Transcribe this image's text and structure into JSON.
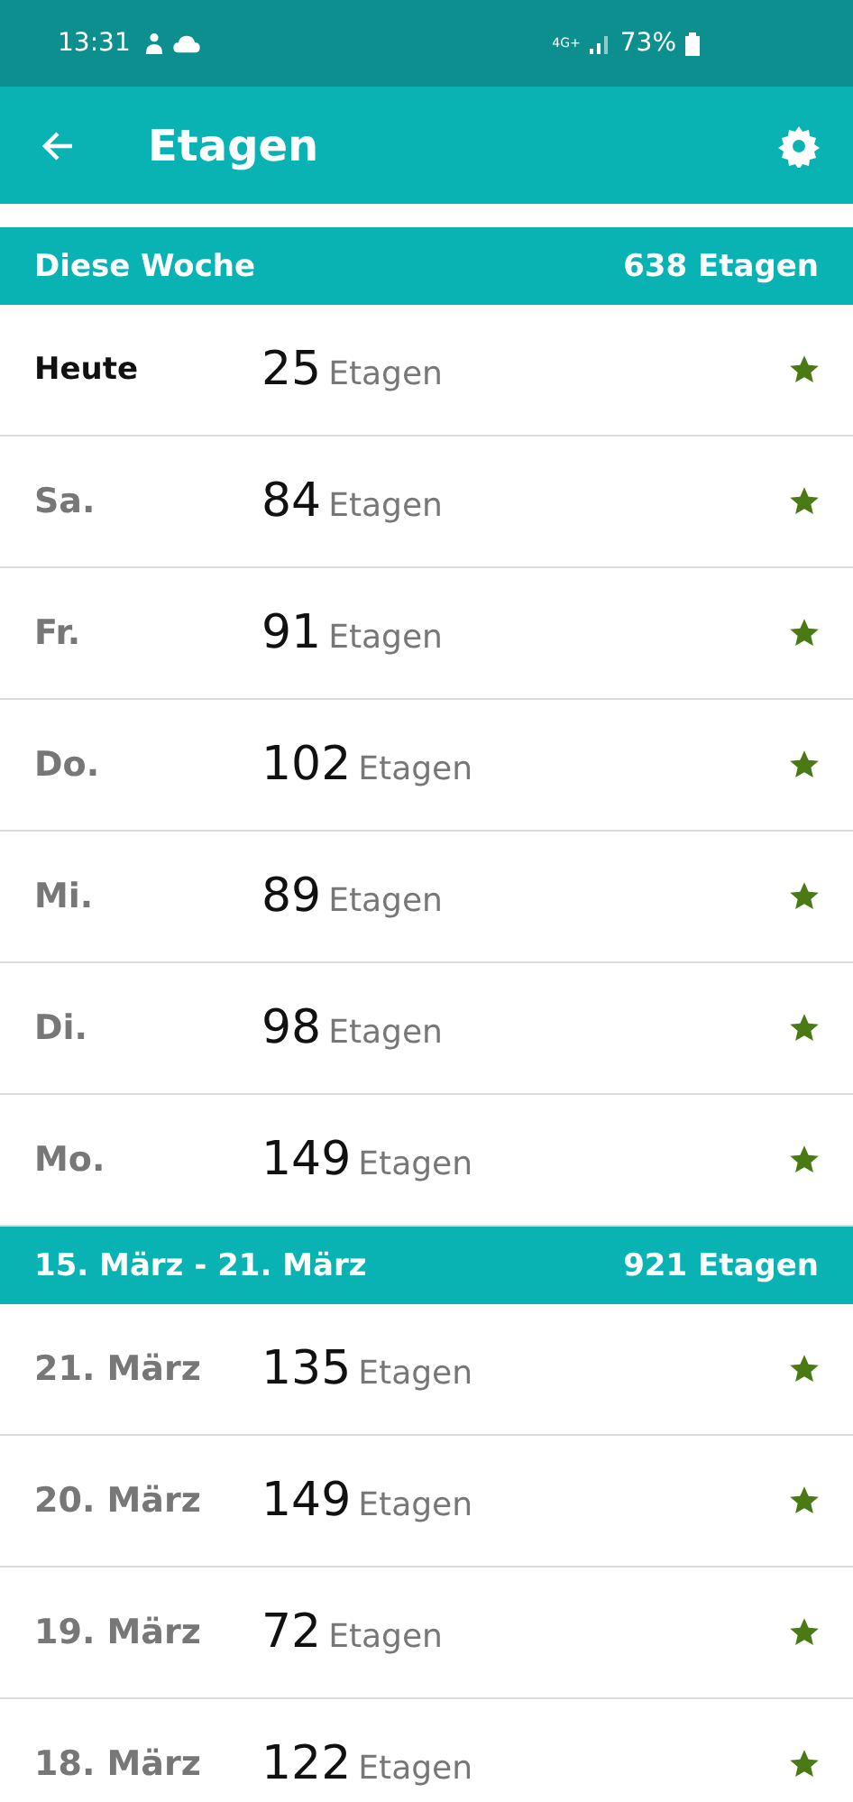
{
  "status_bar": {
    "time": "13:31",
    "network": "4G+",
    "battery": "73%"
  },
  "app_bar": {
    "title": "Etagen"
  },
  "sections": [
    {
      "title": "Diese Woche",
      "total": "638 Etagen",
      "rows": [
        {
          "day": "Heute",
          "count": "25",
          "unit": "Etagen",
          "today": true,
          "goal_met": true
        },
        {
          "day": "Sa.",
          "count": "84",
          "unit": "Etagen",
          "today": false,
          "goal_met": true
        },
        {
          "day": "Fr.",
          "count": "91",
          "unit": "Etagen",
          "today": false,
          "goal_met": true
        },
        {
          "day": "Do.",
          "count": "102",
          "unit": "Etagen",
          "today": false,
          "goal_met": true
        },
        {
          "day": "Mi.",
          "count": "89",
          "unit": "Etagen",
          "today": false,
          "goal_met": true
        },
        {
          "day": "Di.",
          "count": "98",
          "unit": "Etagen",
          "today": false,
          "goal_met": true
        },
        {
          "day": "Mo.",
          "count": "149",
          "unit": "Etagen",
          "today": false,
          "goal_met": true
        }
      ]
    },
    {
      "title": "15. März - 21. März",
      "total": "921 Etagen",
      "rows": [
        {
          "day": "21. März",
          "count": "135",
          "unit": "Etagen",
          "today": false,
          "goal_met": true
        },
        {
          "day": "20. März",
          "count": "149",
          "unit": "Etagen",
          "today": false,
          "goal_met": true
        },
        {
          "day": "19. März",
          "count": "72",
          "unit": "Etagen",
          "today": false,
          "goal_met": true
        },
        {
          "day": "18. März",
          "count": "122",
          "unit": "Etagen",
          "today": false,
          "goal_met": true
        }
      ]
    }
  ]
}
